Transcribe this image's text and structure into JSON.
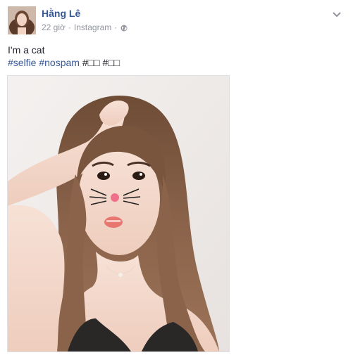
{
  "post": {
    "author_name": "Hằng Lê",
    "timestamp": "22 giờ",
    "source": "Instagram",
    "separator": "·",
    "privacy_icon": "globe-icon",
    "menu_icon": "chevron-down-icon",
    "text": "I'm a cat",
    "hashtags": [
      "#selfie",
      "#nospam",
      "#□□",
      "#□□"
    ]
  },
  "photo": {
    "description_icon": "photo"
  },
  "colors": {
    "link_blue": "#365899",
    "meta_gray": "#90949c",
    "text_dark": "#1d2129"
  }
}
